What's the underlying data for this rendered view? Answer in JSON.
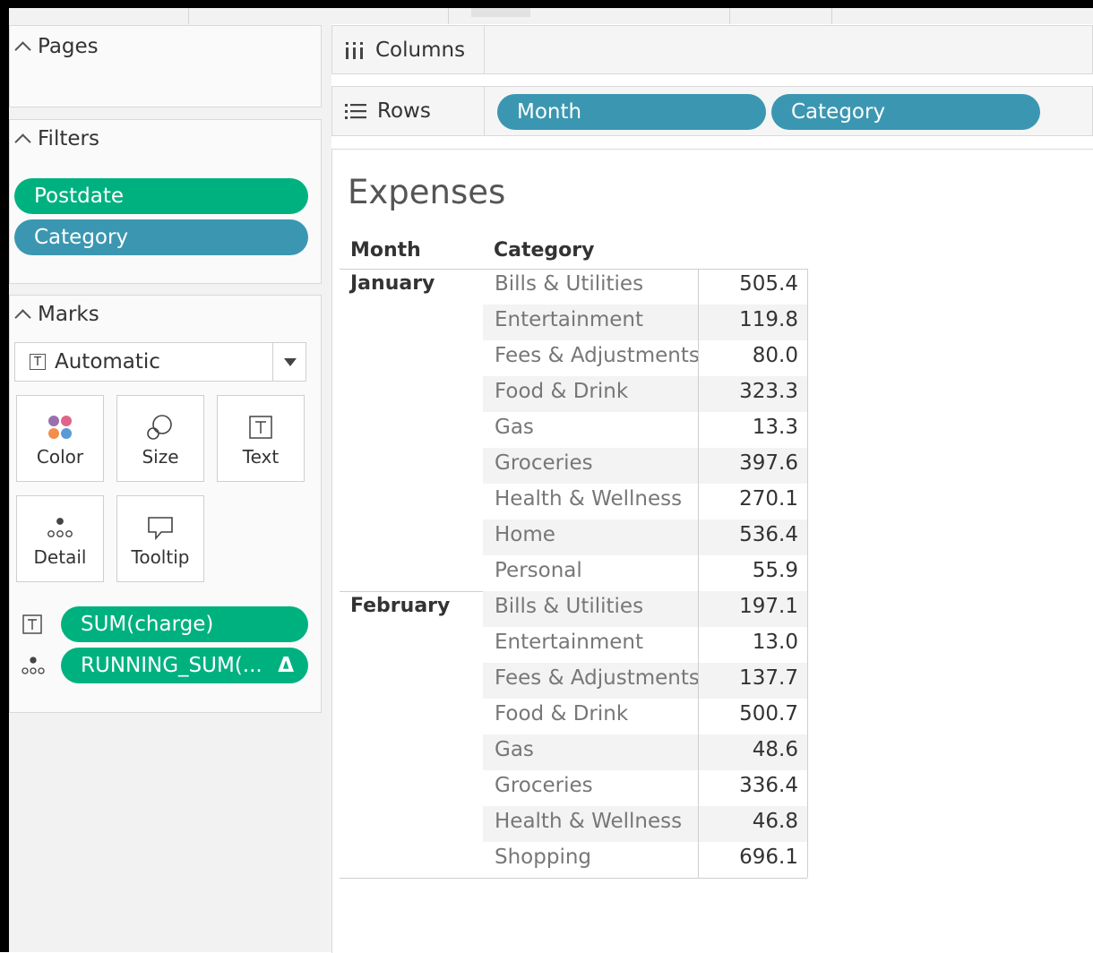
{
  "left_pane": {
    "pages_title": "Pages",
    "filters_title": "Filters",
    "filters": [
      {
        "label": "Postdate",
        "color": "#00b180"
      },
      {
        "label": "Category",
        "color": "#3b97b1"
      }
    ],
    "marks_title": "Marks",
    "mark_type": "Automatic",
    "mark_buttons": {
      "color": "Color",
      "size": "Size",
      "text": "Text",
      "detail": "Detail",
      "tooltip": "Tooltip"
    },
    "mark_fields": [
      {
        "label": "SUM(charge)",
        "icon": "text-icon"
      },
      {
        "label": "RUNNING_SUM(...",
        "icon": "detail-icon",
        "delta": "Δ"
      }
    ]
  },
  "shelves": {
    "columns_label": "Columns",
    "rows_label": "Rows",
    "rows_pills": [
      "Month",
      "Category"
    ]
  },
  "view": {
    "title": "Expenses",
    "headers": {
      "month": "Month",
      "category": "Category"
    },
    "groups": [
      {
        "month": "January",
        "rows": [
          {
            "category": "Bills & Utilities",
            "value": "505.4"
          },
          {
            "category": "Entertainment",
            "value": "119.8"
          },
          {
            "category": "Fees & Adjustments",
            "value": "80.0"
          },
          {
            "category": "Food & Drink",
            "value": "323.3"
          },
          {
            "category": "Gas",
            "value": "13.3"
          },
          {
            "category": "Groceries",
            "value": "397.6"
          },
          {
            "category": "Health & Wellness",
            "value": "270.1"
          },
          {
            "category": "Home",
            "value": "536.4"
          },
          {
            "category": "Personal",
            "value": "55.9"
          }
        ]
      },
      {
        "month": "February",
        "rows": [
          {
            "category": "Bills & Utilities",
            "value": "197.1"
          },
          {
            "category": "Entertainment",
            "value": "13.0"
          },
          {
            "category": "Fees & Adjustments",
            "value": "137.7"
          },
          {
            "category": "Food & Drink",
            "value": "500.7"
          },
          {
            "category": "Gas",
            "value": "48.6"
          },
          {
            "category": "Groceries",
            "value": "336.4"
          },
          {
            "category": "Health & Wellness",
            "value": "46.8"
          },
          {
            "category": "Shopping",
            "value": "696.1"
          }
        ]
      }
    ]
  }
}
